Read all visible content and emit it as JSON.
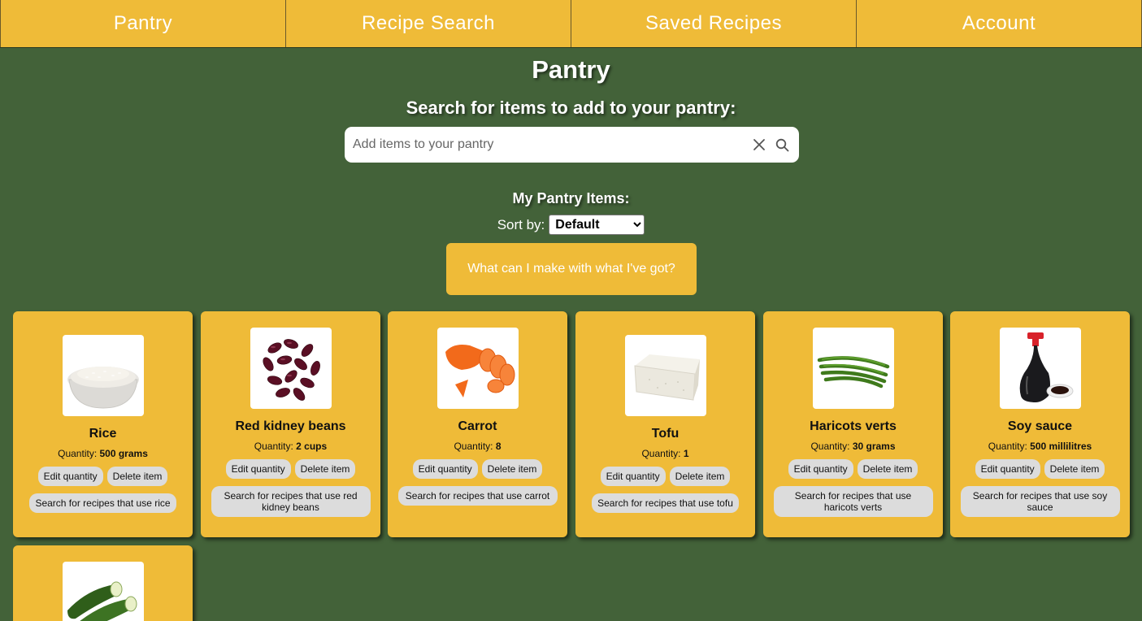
{
  "nav": {
    "tabs": [
      "Pantry",
      "Recipe Search",
      "Saved Recipes",
      "Account"
    ]
  },
  "page": {
    "title": "Pantry",
    "search_heading": "Search for items to add to your pantry:",
    "search_placeholder": "Add items to your pantry",
    "pantry_heading": "My Pantry Items:",
    "sort_label": "Sort by:",
    "sort_value": "Default",
    "make_button": "What can I make with what I've got?"
  },
  "buttons": {
    "edit": "Edit quantity",
    "delete": "Delete item"
  },
  "quantity_label": "Quantity:",
  "items": [
    {
      "name": "Rice",
      "quantity": "500 grams",
      "search": "Search for recipes that use rice",
      "image": "rice-bowl"
    },
    {
      "name": "Red kidney beans",
      "quantity": "2 cups",
      "search": "Search for recipes that use red kidney beans",
      "image": "kidney-beans"
    },
    {
      "name": "Carrot",
      "quantity": "8",
      "search": "Search for recipes that use carrot",
      "image": "carrot"
    },
    {
      "name": "Tofu",
      "quantity": "1",
      "search": "Search for recipes that use tofu",
      "image": "tofu"
    },
    {
      "name": "Haricots verts",
      "quantity": "30 grams",
      "search": "Search for recipes that use haricots verts",
      "image": "green-beans"
    },
    {
      "name": "Soy sauce",
      "quantity": "500 millilitres",
      "search": "Search for recipes that use soy sauce",
      "image": "soy-sauce"
    },
    {
      "name": "",
      "quantity": "",
      "search": "",
      "image": "zucchini"
    }
  ],
  "colors": {
    "background": "#436239",
    "accent": "#efbb38",
    "button": "#dcdcdc"
  }
}
